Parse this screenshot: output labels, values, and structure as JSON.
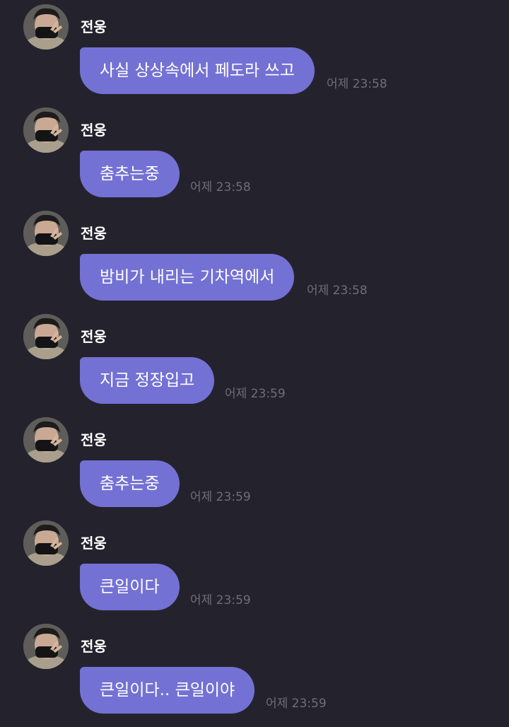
{
  "chat": {
    "messages": [
      {
        "sender": "전웅",
        "text": "사실 상상속에서 페도라 쓰고",
        "time": "어제 23:58"
      },
      {
        "sender": "전웅",
        "text": "춤추는중",
        "time": "어제 23:58"
      },
      {
        "sender": "전웅",
        "text": "밤비가 내리는 기차역에서",
        "time": "어제 23:58"
      },
      {
        "sender": "전웅",
        "text": "지금 정장입고",
        "time": "어제 23:59"
      },
      {
        "sender": "전웅",
        "text": "춤추는중",
        "time": "어제 23:59"
      },
      {
        "sender": "전웅",
        "text": "큰일이다",
        "time": "어제 23:59"
      },
      {
        "sender": "전웅",
        "text": "큰일이다.. 큰일이야",
        "time": "어제 23:59"
      }
    ]
  },
  "colors": {
    "background": "#24232d",
    "bubble": "#7471d4",
    "sender_text": "#ffffff",
    "timestamp": "#6e6e78"
  },
  "icons": {
    "avatar": "profile-photo-icon"
  }
}
